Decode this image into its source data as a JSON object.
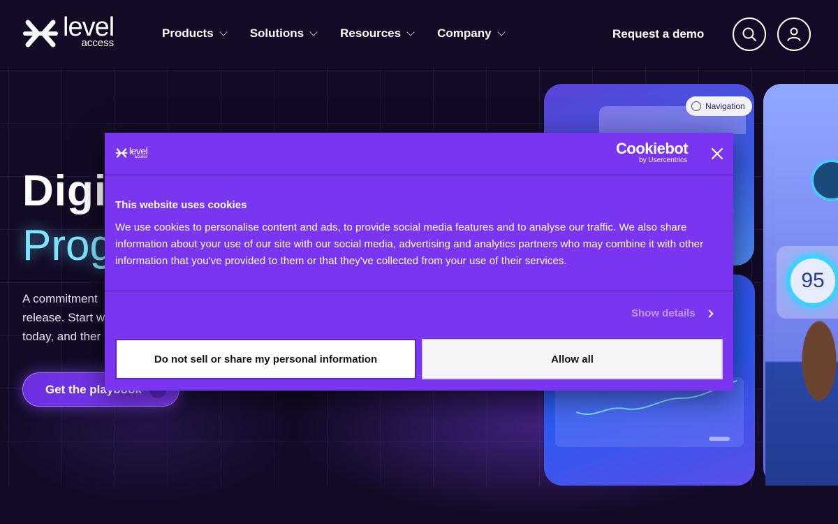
{
  "header": {
    "logo": {
      "word": "level",
      "sub": "access"
    },
    "nav": [
      {
        "label": "Products"
      },
      {
        "label": "Solutions"
      },
      {
        "label": "Resources"
      },
      {
        "label": "Company"
      }
    ],
    "demo_label": "Request a demo",
    "search_icon": "search-icon",
    "user_icon": "user-icon"
  },
  "hero": {
    "title_line1": "Digi",
    "title_line2": "Prog",
    "desc_lines": [
      "A commitment",
      "release. Start w",
      "today, and ther"
    ],
    "cta_label": "Get the playbook"
  },
  "visuals": {
    "nav_tag": "Navigation",
    "score": "95"
  },
  "cookie": {
    "logo": {
      "word": "level",
      "sub": "access"
    },
    "brand": "Cookiebot",
    "brand_sub": "by Usercentrics",
    "title": "This website uses cookies",
    "text": "We use cookies to personalise content and ads, to provide social media features and to analyse our traffic. We also share information about your use of our site with our social media, advertising and analytics partners who may combine it with other information that you've provided to them or that they've collected from your use of their services.",
    "show_details": "Show details",
    "optout_label": "Do not sell or share my personal information",
    "allow_label": "Allow all"
  },
  "colors": {
    "page_bg": "#130b26",
    "dialog_bg": "#7a35f0",
    "hero_accent": "#7fe3ff",
    "cta": "#6b2fe0"
  }
}
